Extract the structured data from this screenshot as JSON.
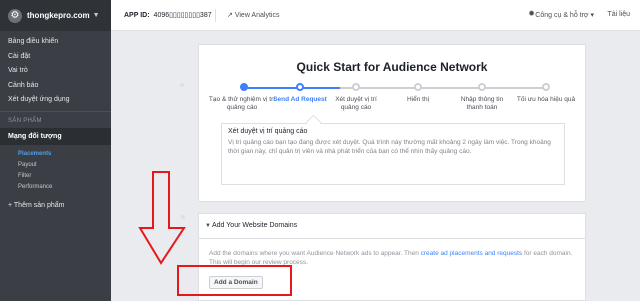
{
  "sidebar": {
    "app_name": "thongkepro.com",
    "items": [
      {
        "label": "Bảng điều khiển"
      },
      {
        "label": "Cài đặt"
      },
      {
        "label": "Vai trò"
      },
      {
        "label": "Cảnh báo"
      },
      {
        "label": "Xét duyệt ứng dụng"
      }
    ],
    "section_label": "SẢN PHẨM",
    "active_product": "Mạng đối tượng",
    "sub_items": [
      {
        "label": "Placements",
        "active": true
      },
      {
        "label": "Payout"
      },
      {
        "label": "Filter"
      },
      {
        "label": "Performance"
      }
    ],
    "add_product": "+ Thêm sản phẩm"
  },
  "topbar": {
    "app_id_label": "APP ID:",
    "app_id_value": "4096▯▯▯▯▯▯▯▯387",
    "view_analytics": "View Analytics",
    "tools_help": "Công cụ & hỗ trợ",
    "docs": "Tài liệu"
  },
  "quickstart": {
    "title": "Quick Start for Audience Network",
    "steps": [
      {
        "label": "Tạo & thử nghiệm vị trí quảng cáo",
        "state": "done"
      },
      {
        "label": "Send Ad Request",
        "state": "current"
      },
      {
        "label": "Xét duyệt vị trí quảng cáo",
        "state": "todo"
      },
      {
        "label": "Hiển thị",
        "state": "todo"
      },
      {
        "label": "Nhập thông tin thanh toán",
        "state": "todo"
      },
      {
        "label": "Tối ưu hóa hiệu quả",
        "state": "todo"
      }
    ],
    "tip_title": "Xét duyệt vị trí quảng cáo",
    "tip_body": "Vị trí quảng cáo bạn tạo đang được xét duyệt. Quá trình này thường mất khoảng 2 ngày làm việc. Trong khoảng thời gian này, chỉ quản trị viên và nhà phát triển của bạn có thể nhìn thấy quảng cáo."
  },
  "domains": {
    "title": "Add Your Website Domains",
    "body_before": "Add the domains where you want Audience Network ads to appear. Then ",
    "body_link": "create ad placements and requests",
    "body_after": " for each domain. This will begin our review process.",
    "add_button": "Add a Domain"
  },
  "colors": {
    "accent": "#4080ff",
    "annotation_red": "#e5191b",
    "sidebar_bg": "#3b3f45"
  },
  "icons": {
    "app": "gear-icon",
    "analytics": "trend-icon",
    "tools": "bug-icon",
    "collapse": "triangle-down-icon"
  }
}
